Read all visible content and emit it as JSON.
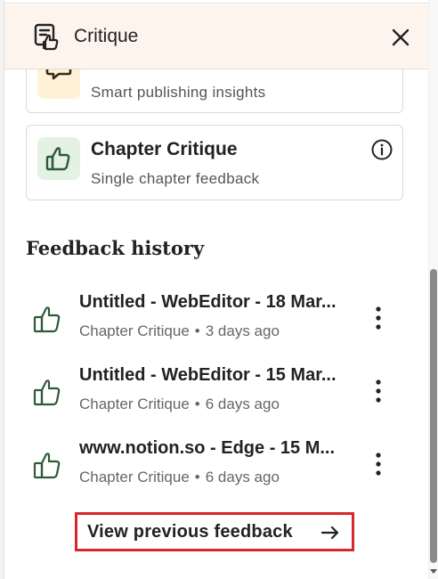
{
  "header": {
    "title": "Critique"
  },
  "cards": [
    {
      "subtitle": "Smart publishing insights",
      "icon": "megaphone-icon"
    },
    {
      "title": "Chapter Critique",
      "subtitle": "Single chapter feedback",
      "icon": "thumbs-up-icon"
    }
  ],
  "history": {
    "heading": "Feedback history",
    "items": [
      {
        "title": "Untitled - WebEditor - 18 Mar...",
        "type": "Chapter Critique",
        "separator": "•",
        "time": "3 days ago"
      },
      {
        "title": "Untitled - WebEditor - 15 Mar...",
        "type": "Chapter Critique",
        "separator": "•",
        "time": "6 days ago"
      },
      {
        "title": "www.notion.so - Edge - 15 M...",
        "type": "Chapter Critique",
        "separator": "•",
        "time": "6 days ago"
      }
    ],
    "view_previous_label": "View previous feedback"
  },
  "colors": {
    "header_bg": "#fdf4ee",
    "accent_green": "#2f5a37",
    "highlight_red": "#d9262c"
  }
}
